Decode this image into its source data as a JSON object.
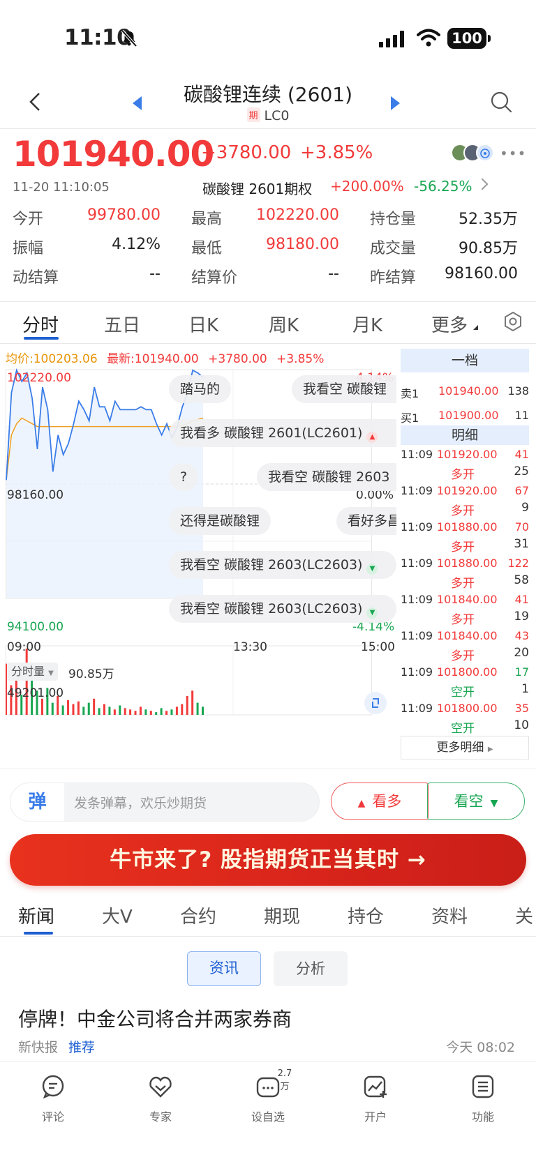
{
  "status": {
    "time": "11:10",
    "battery": "100"
  },
  "nav": {
    "title": "碳酸锂连续 (2601)",
    "badge": "期",
    "code": "LC0"
  },
  "quote": {
    "last": "101940.00",
    "change": "+3780.00",
    "pct": "+3.85%",
    "time": "11-20 11:10:05",
    "option_name": "碳酸锂 2601期权",
    "option_up": "+200.00%",
    "option_down": "-56.25%",
    "fields": [
      {
        "label": "今开",
        "value": "99780.00",
        "color": "red"
      },
      {
        "label": "最高",
        "value": "102220.00",
        "color": "red"
      },
      {
        "label": "持仓量",
        "value": "52.35万",
        "color": "black"
      },
      {
        "label": "振幅",
        "value": "4.12%",
        "color": "black"
      },
      {
        "label": "最低",
        "value": "98180.00",
        "color": "red"
      },
      {
        "label": "成交量",
        "value": "90.85万",
        "color": "black"
      },
      {
        "label": "动结算",
        "value": "--",
        "color": "black"
      },
      {
        "label": "结算价",
        "value": "--",
        "color": "black"
      },
      {
        "label": "昨结算",
        "value": "98160.00",
        "color": "black"
      }
    ]
  },
  "ktabs": [
    "分时",
    "五日",
    "日K",
    "周K",
    "月K",
    "更多"
  ],
  "chart_info": {
    "avg": "均价:100203.06",
    "latest": "最新:101940.00",
    "change": "+3780.00",
    "pct": "+3.85%"
  },
  "chart": {
    "y_high": "102220.00",
    "y_high_pct": "4.14%",
    "y_mid": "98160.00",
    "y_mid_pct": "0.00%",
    "y_low": "94100.00",
    "y_low_pct": "-4.14%",
    "x_start": "09:00",
    "x_mid": "13:30",
    "x_end": "15:00",
    "vol_label": "分时量",
    "vol_total": "90.85万",
    "vol_max": "49201.00"
  },
  "chart_data": {
    "type": "line",
    "ylim": [
      94100,
      102220
    ],
    "series": [
      {
        "values": [
          98300,
          101400,
          102200,
          101800,
          102100,
          101200,
          99400,
          101600,
          100800,
          98600,
          99900,
          99200,
          99600,
          100300,
          101100,
          100800,
          100400,
          101600,
          100900,
          100900,
          100400,
          101100,
          100800,
          100800,
          100800,
          100800,
          100900,
          100800,
          100800,
          100300,
          99900,
          100300,
          99800,
          100200,
          100900,
          101400,
          102200,
          102100,
          101940
        ]
      },
      {
        "values": [
          98300,
          99900,
          100300,
          100500,
          100400,
          100300,
          100200,
          100200,
          100200,
          100200,
          100200,
          100200,
          100200,
          100200,
          100200,
          100200,
          100200,
          100200,
          100200,
          100200,
          100200,
          100200,
          100200,
          100200,
          100200,
          100200,
          100200,
          100200,
          100200,
          100200,
          100200,
          100200,
          100200,
          100200,
          100250,
          100300,
          100400,
          100450,
          100500
        ]
      }
    ],
    "volume": [
      38000,
      22000,
      31000,
      15000,
      49201,
      26000,
      18000,
      12000,
      20000,
      9000,
      14000,
      7000,
      11000,
      8000,
      10000,
      6000,
      9000,
      12000,
      5000,
      8000,
      6000,
      4000,
      7000,
      5000,
      4000,
      3000,
      6000,
      4000,
      3000,
      2000,
      5000,
      3000,
      4000,
      6000,
      8000,
      14000,
      18000,
      9000,
      6000
    ]
  },
  "danmaku": [
    {
      "text": "踏马的"
    },
    {
      "text": "我看空 碳酸锂"
    },
    {
      "text": "我看多 碳酸锂 2601(LC2601)",
      "dir": "up"
    },
    {
      "text": "?"
    },
    {
      "text": "我看空 碳酸锂 2603"
    },
    {
      "text": "还得是碳酸锂"
    },
    {
      "text": "看好多昌"
    },
    {
      "text": "我看空 碳酸锂 2603(LC2603)",
      "dir": "down"
    },
    {
      "text": "我看空 碳酸锂 2603(LC2603)",
      "dir": "down"
    }
  ],
  "orderbook": {
    "level_label": "一档",
    "ask": {
      "label": "卖1",
      "price": "101940.00",
      "vol": "138"
    },
    "bid": {
      "label": "买1",
      "price": "101900.00",
      "vol": "11"
    },
    "detail_label": "明细",
    "trades": [
      {
        "time": "11:09",
        "price": "101920.00",
        "vol": "41",
        "vol_color": "red",
        "type": "多开",
        "type_color": "red",
        "n": "25"
      },
      {
        "time": "11:09",
        "price": "101920.00",
        "vol": "67",
        "vol_color": "red",
        "type": "多开",
        "type_color": "red",
        "n": "9"
      },
      {
        "time": "11:09",
        "price": "101880.00",
        "vol": "70",
        "vol_color": "red",
        "type": "多开",
        "type_color": "red",
        "n": "31"
      },
      {
        "time": "11:09",
        "price": "101880.00",
        "vol": "122",
        "vol_color": "red",
        "type": "多开",
        "type_color": "red",
        "n": "58"
      },
      {
        "time": "11:09",
        "price": "101840.00",
        "vol": "41",
        "vol_color": "red",
        "type": "多开",
        "type_color": "red",
        "n": "19"
      },
      {
        "time": "11:09",
        "price": "101840.00",
        "vol": "43",
        "vol_color": "red",
        "type": "多开",
        "type_color": "red",
        "n": "20"
      },
      {
        "time": "11:09",
        "price": "101800.00",
        "vol": "17",
        "vol_color": "green",
        "type": "空开",
        "type_color": "green",
        "n": "1"
      },
      {
        "time": "11:09",
        "price": "101800.00",
        "vol": "35",
        "vol_color": "red",
        "type": "空开",
        "type_color": "green",
        "n": "10"
      }
    ],
    "more": "更多明细"
  },
  "comment": {
    "logo": "弹",
    "placeholder": "发条弹幕，欢乐炒期货",
    "long": "看多",
    "short": "看空"
  },
  "banner": {
    "text": "牛市来了? 股指期货正当其时 →"
  },
  "news_tabs": [
    "新闻",
    "大V",
    "合约",
    "期现",
    "持仓",
    "资料",
    "关"
  ],
  "segments": {
    "news": "资讯",
    "analysis": "分析"
  },
  "news": {
    "title": "停牌！中金公司将合并两家券商",
    "source": "新快报",
    "tag": "推荐",
    "time": "今天 08:02"
  },
  "bottom": [
    {
      "label": "评论",
      "icon": "comment-icon"
    },
    {
      "label": "专家",
      "icon": "expert-icon"
    },
    {
      "label": "设自选",
      "icon": "watchlist-icon",
      "badge": "2.7万"
    },
    {
      "label": "开户",
      "icon": "open-account-icon"
    },
    {
      "label": "功能",
      "icon": "menu-icon"
    }
  ],
  "colors": {
    "up": "#f23a3a",
    "down": "#19a652",
    "accent": "#1e5fd1",
    "avg_line": "#f0a020",
    "price_line": "#3a7de8"
  }
}
